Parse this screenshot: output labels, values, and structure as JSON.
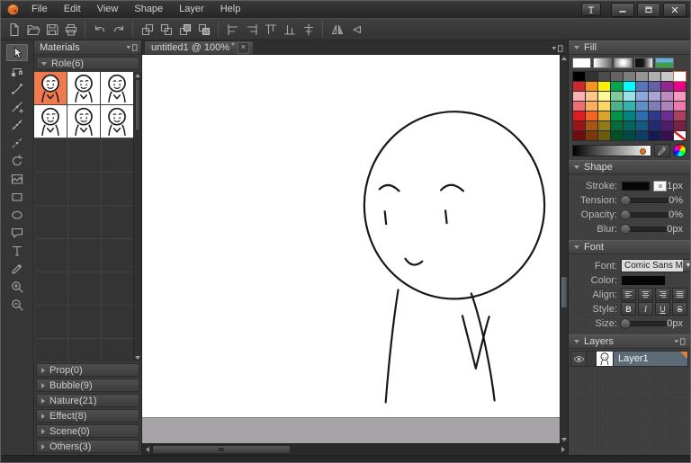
{
  "titlebar": {
    "menus": [
      {
        "label": "File",
        "name": "menu-file"
      },
      {
        "label": "Edit",
        "name": "menu-edit"
      },
      {
        "label": "View",
        "name": "menu-view"
      },
      {
        "label": "Shape",
        "name": "menu-shape"
      },
      {
        "label": "Layer",
        "name": "menu-layer"
      },
      {
        "label": "Help",
        "name": "menu-help"
      }
    ],
    "controls": [
      {
        "name": "pin-button",
        "icon": "pin-icon"
      },
      {
        "name": "minimize-button",
        "icon": "minimize-icon"
      },
      {
        "name": "maximize-button",
        "icon": "maximize-icon"
      },
      {
        "name": "close-button",
        "icon": "close-icon"
      }
    ]
  },
  "toolbar": {
    "groups": [
      [
        {
          "name": "new-button",
          "icon": "new-icon"
        },
        {
          "name": "open-button",
          "icon": "open-icon"
        },
        {
          "name": "save-button",
          "icon": "save-icon"
        },
        {
          "name": "print-button",
          "icon": "print-icon"
        }
      ],
      [
        {
          "name": "undo-button",
          "icon": "undo-icon"
        },
        {
          "name": "redo-button",
          "icon": "redo-icon"
        }
      ],
      [
        {
          "name": "bring-forward-button",
          "icon": "bring-forward-icon"
        },
        {
          "name": "send-backward-button",
          "icon": "send-backward-icon"
        },
        {
          "name": "bring-to-front-button",
          "icon": "bring-to-front-icon"
        },
        {
          "name": "send-to-back-button",
          "icon": "send-to-back-icon"
        }
      ],
      [
        {
          "name": "align-left-button",
          "icon": "align-left-icon"
        },
        {
          "name": "align-right-button",
          "icon": "align-right-icon"
        },
        {
          "name": "align-top-button",
          "icon": "align-top-icon"
        },
        {
          "name": "align-bottom-button",
          "icon": "align-bottom-icon"
        },
        {
          "name": "align-center-button",
          "icon": "align-center-icon"
        }
      ],
      [
        {
          "name": "flip-horizontal-button",
          "icon": "flip-horizontal-icon"
        },
        {
          "name": "flip-vertical-button",
          "icon": "flip-vertical-icon"
        }
      ]
    ]
  },
  "toolstrip": {
    "tools": [
      {
        "name": "select-tool",
        "icon": "select-tool-icon",
        "active": true
      },
      {
        "name": "node-edit-tool",
        "icon": "node-edit-tool-icon"
      },
      {
        "name": "curve-tool",
        "icon": "curve-tool-icon"
      },
      {
        "name": "add-point-tool",
        "icon": "add-point-tool-icon"
      },
      {
        "name": "convert-point-tool",
        "icon": "convert-point-tool-icon"
      },
      {
        "name": "sketch-tool",
        "icon": "sketch-tool-icon"
      },
      {
        "name": "rotate-tool",
        "icon": "rotate-tool-icon"
      },
      {
        "name": "frame-tool",
        "icon": "frame-tool-icon"
      },
      {
        "name": "rectangle-tool",
        "icon": "rectangle-tool-icon"
      },
      {
        "name": "ellipse-tool",
        "icon": "ellipse-tool-icon"
      },
      {
        "name": "bubble-tool",
        "icon": "bubble-tool-icon"
      },
      {
        "name": "text-tool",
        "icon": "text-tool-icon"
      },
      {
        "name": "pen-tool",
        "icon": "pen-tool-icon"
      },
      {
        "name": "zoom-in-tool",
        "icon": "zoom-in-tool-icon"
      },
      {
        "name": "zoom-out-tool",
        "icon": "zoom-out-tool-icon"
      }
    ]
  },
  "materials": {
    "title": "Materials",
    "role_header": "Role(6)",
    "role_items": [
      {
        "name": "role-item",
        "icon": "role-character-icon",
        "selected": true
      },
      {
        "name": "role-item",
        "icon": "role-character-icon"
      },
      {
        "name": "role-item",
        "icon": "role-character-icon"
      },
      {
        "name": "role-item",
        "icon": "role-character-icon"
      },
      {
        "name": "role-item",
        "icon": "role-character-icon"
      },
      {
        "name": "role-item",
        "icon": "role-character-icon"
      }
    ],
    "categories": [
      {
        "label": "Prop(0)",
        "name": "category-prop"
      },
      {
        "label": "Bubble(9)",
        "name": "category-bubble"
      },
      {
        "label": "Nature(21)",
        "name": "category-nature"
      },
      {
        "label": "Effect(8)",
        "name": "category-effect"
      },
      {
        "label": "Scene(0)",
        "name": "category-scene"
      },
      {
        "label": "Others(3)",
        "name": "category-others"
      }
    ]
  },
  "canvas": {
    "tab": {
      "title": "untitled1 @ 100%",
      "modified": "*",
      "close": "×"
    }
  },
  "fill": {
    "title": "Fill",
    "types": [
      {
        "name": "fill-type-solid",
        "style": "solid"
      },
      {
        "name": "fill-type-linear-gradient",
        "style": "linear"
      },
      {
        "name": "fill-type-radial-gradient",
        "style": "radial"
      },
      {
        "name": "fill-type-contour-gradient",
        "style": "corner"
      },
      {
        "name": "fill-type-bitmap",
        "style": "bitmap"
      }
    ],
    "palette": [
      {
        "color": "#000000"
      },
      {
        "color": "#323232"
      },
      {
        "color": "#4b4b4b"
      },
      {
        "color": "#646464"
      },
      {
        "color": "#7d7d7d"
      },
      {
        "color": "#969696"
      },
      {
        "color": "#afafaf"
      },
      {
        "color": "#c8c8c8"
      },
      {
        "color": "#ffffff",
        "selected": true
      },
      {
        "color": "#cf272f"
      },
      {
        "color": "#f7941d"
      },
      {
        "color": "#fff200"
      },
      {
        "color": "#00a651"
      },
      {
        "color": "#00ffff"
      },
      {
        "color": "#5674b9"
      },
      {
        "color": "#6460aa"
      },
      {
        "color": "#92278f"
      },
      {
        "color": "#ec008c"
      },
      {
        "color": "#f8b3b5"
      },
      {
        "color": "#fdc68a"
      },
      {
        "color": "#fff799"
      },
      {
        "color": "#82ca9c"
      },
      {
        "color": "#9ce0e8"
      },
      {
        "color": "#8da9db"
      },
      {
        "color": "#aaa5d3"
      },
      {
        "color": "#bc8dbf"
      },
      {
        "color": "#f49ac1"
      },
      {
        "color": "#ee6e73"
      },
      {
        "color": "#fbaf5d"
      },
      {
        "color": "#ffd65e"
      },
      {
        "color": "#4cb384"
      },
      {
        "color": "#2fb5ae"
      },
      {
        "color": "#5f8fc7"
      },
      {
        "color": "#7f7db8"
      },
      {
        "color": "#aa84bb"
      },
      {
        "color": "#f078ae"
      },
      {
        "color": "#e01b22"
      },
      {
        "color": "#f26522"
      },
      {
        "color": "#d9a427"
      },
      {
        "color": "#00944a"
      },
      {
        "color": "#00847c"
      },
      {
        "color": "#2c6fb0"
      },
      {
        "color": "#32388c"
      },
      {
        "color": "#6b2d90"
      },
      {
        "color": "#ad3f63"
      },
      {
        "color": "#a01215"
      },
      {
        "color": "#a85613"
      },
      {
        "color": "#8f7d14"
      },
      {
        "color": "#056b38"
      },
      {
        "color": "#03655c"
      },
      {
        "color": "#135a85"
      },
      {
        "color": "#232a73"
      },
      {
        "color": "#501a6e"
      },
      {
        "color": "#7c1f45"
      },
      {
        "color": "#6e0d10"
      },
      {
        "color": "#7a3a0d"
      },
      {
        "color": "#6b5c0f"
      },
      {
        "color": "#004f27"
      },
      {
        "color": "#004a43"
      },
      {
        "color": "#0d3f62"
      },
      {
        "color": "#171a52"
      },
      {
        "color": "#38104f"
      },
      {
        "none": true
      }
    ]
  },
  "shape": {
    "title": "Shape",
    "stroke": {
      "label": "Stroke:",
      "value": "1px"
    },
    "tension": {
      "label": "Tension:",
      "value": "0%"
    },
    "opacity": {
      "label": "Opacity:",
      "value": "0%"
    },
    "blur": {
      "label": "Blur:",
      "value": "0px"
    }
  },
  "font": {
    "title": "Font",
    "font_label": "Font:",
    "font_value": "Comic Sans M",
    "color_label": "Color:",
    "align_label": "Align:",
    "align_buttons": [
      {
        "name": "text-align-left-button",
        "icon": "text-align-left-icon"
      },
      {
        "name": "text-align-center-button",
        "icon": "text-align-center-icon"
      },
      {
        "name": "text-align-right-button",
        "icon": "text-align-right-icon"
      },
      {
        "name": "text-align-justify-button",
        "icon": "text-align-justify-icon"
      }
    ],
    "style_label": "Style:",
    "style_buttons": [
      {
        "name": "bold-button",
        "label": "B",
        "style": "bold"
      },
      {
        "name": "italic-button",
        "label": "I",
        "style": "italic"
      },
      {
        "name": "underline-button",
        "label": "U",
        "style": "underline"
      },
      {
        "name": "strikethrough-button",
        "label": "S",
        "style": "strike"
      }
    ],
    "size_label": "Size:",
    "size_value": "0px"
  },
  "layers": {
    "title": "Layers",
    "layer": {
      "name": "Layer1"
    }
  }
}
